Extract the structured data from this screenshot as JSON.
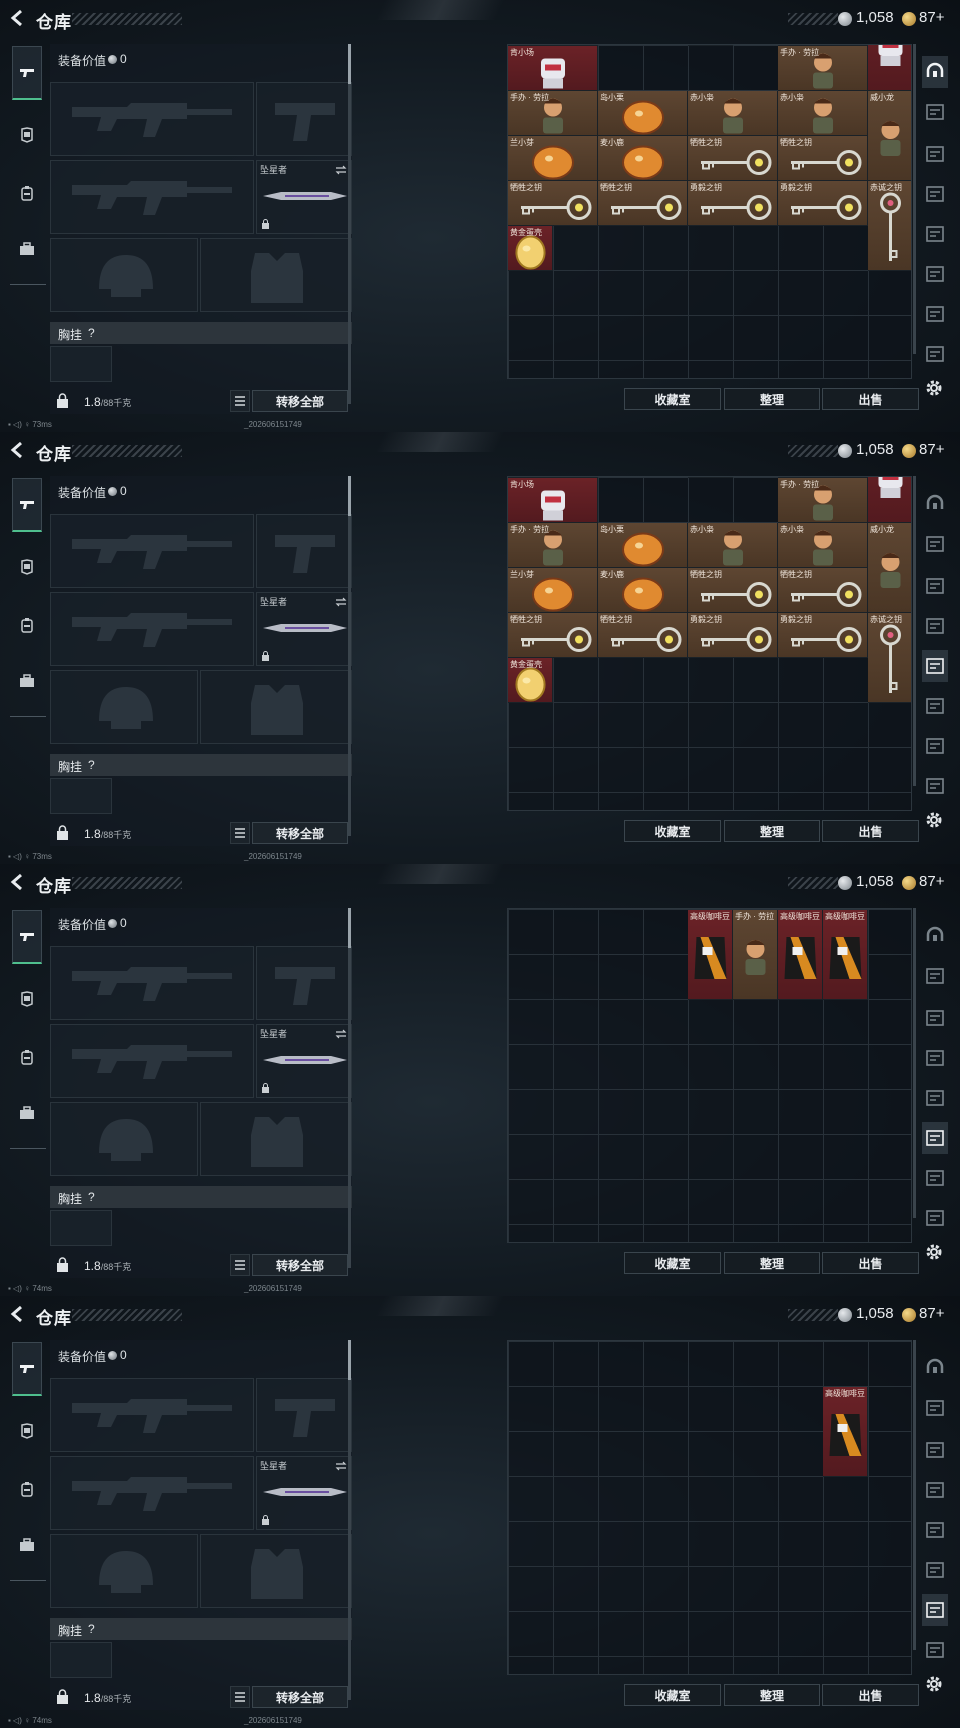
{
  "app": {
    "title": "仓库",
    "currency_silver": "1,058",
    "currency_gold": "87",
    "currency_plus": "+"
  },
  "equip": {
    "value_label": "装备价值",
    "value": "0",
    "knife_name": "坠星者",
    "chest_label": "胸挂",
    "chest_hint": "?",
    "weight": "1.8",
    "weight_max": "/88千克",
    "transfer_all": "转移全部"
  },
  "buttons": {
    "collection": "收藏室",
    "sort": "整理",
    "sell": "出售"
  },
  "status": {
    "ping": [
      "73ms",
      "73ms",
      "74ms",
      "74ms"
    ],
    "build": "_202606151749"
  },
  "frames": [
    {
      "items": [
        {
          "name": "",
          "col": 0,
          "row": -1,
          "w": 2,
          "h": 1,
          "bg": "red",
          "art": "top-partial"
        },
        {
          "name": "",
          "col": 4,
          "row": -1,
          "w": 1,
          "h": 1,
          "bg": "brown",
          "art": "egg"
        },
        {
          "name": "",
          "col": 6,
          "row": -1,
          "w": 2,
          "h": 1,
          "bg": "red",
          "art": "top-partial"
        },
        {
          "name": "肯小场",
          "col": 0,
          "row": 0,
          "w": 2,
          "h": 1,
          "bg": "red",
          "art": "robot"
        },
        {
          "name": "手办 · 劳拉",
          "col": 6,
          "row": 0,
          "w": 2,
          "h": 1,
          "bg": "brown",
          "art": "figure"
        },
        {
          "name": "",
          "col": 8,
          "row": -1,
          "w": 1,
          "h": 2,
          "bg": "red",
          "art": "robot"
        },
        {
          "name": "手办 · 劳拉",
          "col": 0,
          "row": 1,
          "w": 2,
          "h": 1,
          "bg": "brown",
          "art": "figure"
        },
        {
          "name": "岛小栗",
          "col": 2,
          "row": 1,
          "w": 2,
          "h": 1,
          "bg": "brown",
          "art": "egg"
        },
        {
          "name": "赤小枭",
          "col": 4,
          "row": 1,
          "w": 2,
          "h": 1,
          "bg": "brown",
          "art": "soldier"
        },
        {
          "name": "赤小枭",
          "col": 6,
          "row": 1,
          "w": 2,
          "h": 1,
          "bg": "brown",
          "art": "soldier"
        },
        {
          "name": "威小龙",
          "col": 8,
          "row": 1,
          "w": 1,
          "h": 2,
          "bg": "brown",
          "art": "standing"
        },
        {
          "name": "兰小芽",
          "col": 0,
          "row": 2,
          "w": 2,
          "h": 1,
          "bg": "brown",
          "art": "egg"
        },
        {
          "name": "麦小鹿",
          "col": 2,
          "row": 2,
          "w": 2,
          "h": 1,
          "bg": "brown",
          "art": "egg"
        },
        {
          "name": "牺牲之钥",
          "col": 4,
          "row": 2,
          "w": 2,
          "h": 1,
          "bg": "brown",
          "art": "key"
        },
        {
          "name": "牺牲之钥",
          "col": 6,
          "row": 2,
          "w": 2,
          "h": 1,
          "bg": "brown",
          "art": "key"
        },
        {
          "name": "牺牲之钥",
          "col": 0,
          "row": 3,
          "w": 2,
          "h": 1,
          "bg": "brown",
          "art": "key"
        },
        {
          "name": "牺牲之钥",
          "col": 2,
          "row": 3,
          "w": 2,
          "h": 1,
          "bg": "brown",
          "art": "key"
        },
        {
          "name": "勇毅之钥",
          "col": 4,
          "row": 3,
          "w": 2,
          "h": 1,
          "bg": "brown",
          "art": "key"
        },
        {
          "name": "勇毅之钥",
          "col": 6,
          "row": 3,
          "w": 2,
          "h": 1,
          "bg": "brown",
          "art": "key"
        },
        {
          "name": "赤诚之钥",
          "col": 8,
          "row": 3,
          "w": 1,
          "h": 2,
          "bg": "brown",
          "art": "vkey"
        },
        {
          "name": "黄金蛋壳",
          "col": 0,
          "row": 4,
          "w": 1,
          "h": 1,
          "bg": "red",
          "art": "golden-egg"
        }
      ],
      "active_right_tab": 0
    },
    {
      "items": "same-as-0",
      "active_right_tab": 4
    },
    {
      "items": [
        {
          "name": "高级咖啡豆",
          "col": 4,
          "row": 0,
          "w": 1,
          "h": 2,
          "bg": "red",
          "art": "coffee"
        },
        {
          "name": "手办 · 劳拉",
          "col": 5,
          "row": 0,
          "w": 1,
          "h": 2,
          "bg": "brown",
          "art": "figure"
        },
        {
          "name": "高级咖啡豆",
          "col": 6,
          "row": 0,
          "w": 1,
          "h": 2,
          "bg": "red",
          "art": "coffee"
        },
        {
          "name": "高级咖啡豆",
          "col": 7,
          "row": 0,
          "w": 1,
          "h": 2,
          "bg": "red",
          "art": "coffee"
        }
      ],
      "active_right_tab": 5
    },
    {
      "items": [
        {
          "name": "高级咖啡豆",
          "col": 7,
          "row": 1,
          "w": 1,
          "h": 2,
          "bg": "red",
          "art": "coffee"
        }
      ],
      "active_right_tab": 6
    }
  ],
  "colors": {
    "accent": "#4fbf8e",
    "slot_brown": "#5e4632",
    "slot_red": "#6b2227"
  },
  "icons": {
    "left_tabs": [
      "weapon-icon",
      "armor-icon",
      "bag-icon",
      "case-icon"
    ],
    "right_tabs": [
      "helmet-icon",
      "storage-1-icon",
      "storage-2-icon",
      "storage-3-icon",
      "storage-4-icon",
      "storage-5-icon",
      "storage-6-icon",
      "storage-7-icon"
    ]
  }
}
